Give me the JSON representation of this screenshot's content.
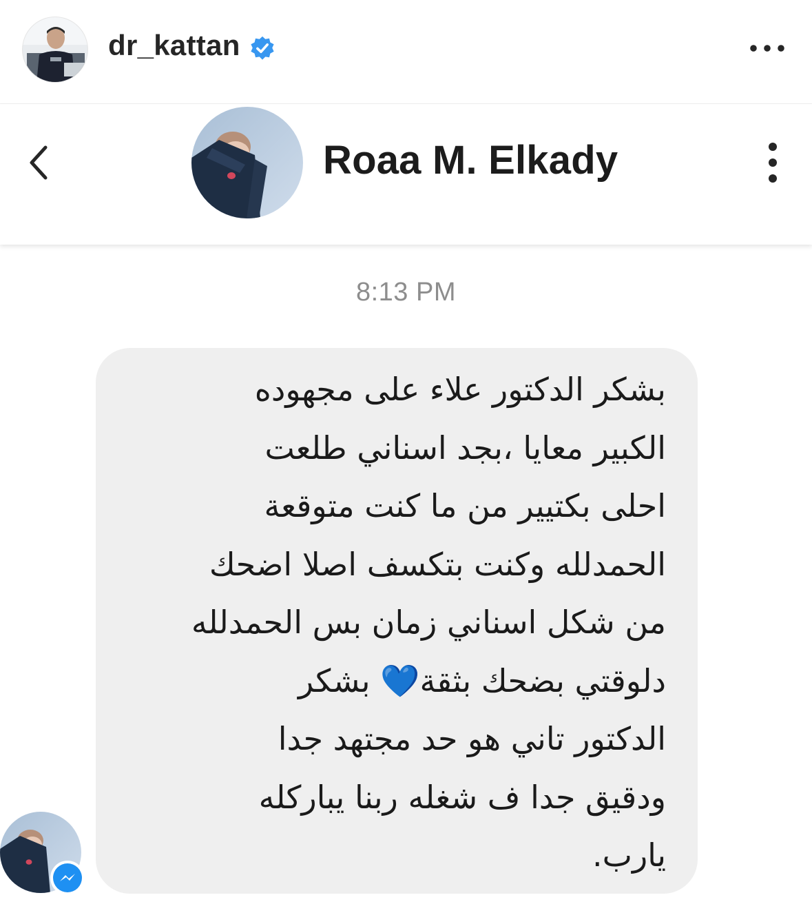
{
  "post": {
    "username": "dr_kattan",
    "verified_icon": "verified-badge-icon",
    "more_icon": "more-horizontal-icon"
  },
  "chat": {
    "contact_name": "Roaa M. Elkady",
    "back_icon": "chevron-left-icon",
    "options_icon": "more-vertical-icon",
    "timestamp": "8:13 PM",
    "message_lines": [
      "بشكر الدكتور علاء على مجهوده",
      "الكبير معايا ،بجد اسناني طلعت",
      "احلى بكتيير من ما كنت متوقعة",
      "الحمدلله وكنت بتكسف اصلا اضحك",
      "من شكل اسناني زمان بس الحمدلله",
      "دلوقتي بضحك بثقة💙 بشكر",
      "الدكتور تاني هو حد مجتهد جدا",
      "ودقيق جدا ف شغله ربنا يباركله",
      "يارب."
    ],
    "message_emoji": "💙",
    "badge_icon": "messenger-icon"
  },
  "colors": {
    "verified": "#3897f0",
    "bubble": "#efefef",
    "timestamp": "#8d8d8d",
    "messenger": "#1e90f2"
  }
}
